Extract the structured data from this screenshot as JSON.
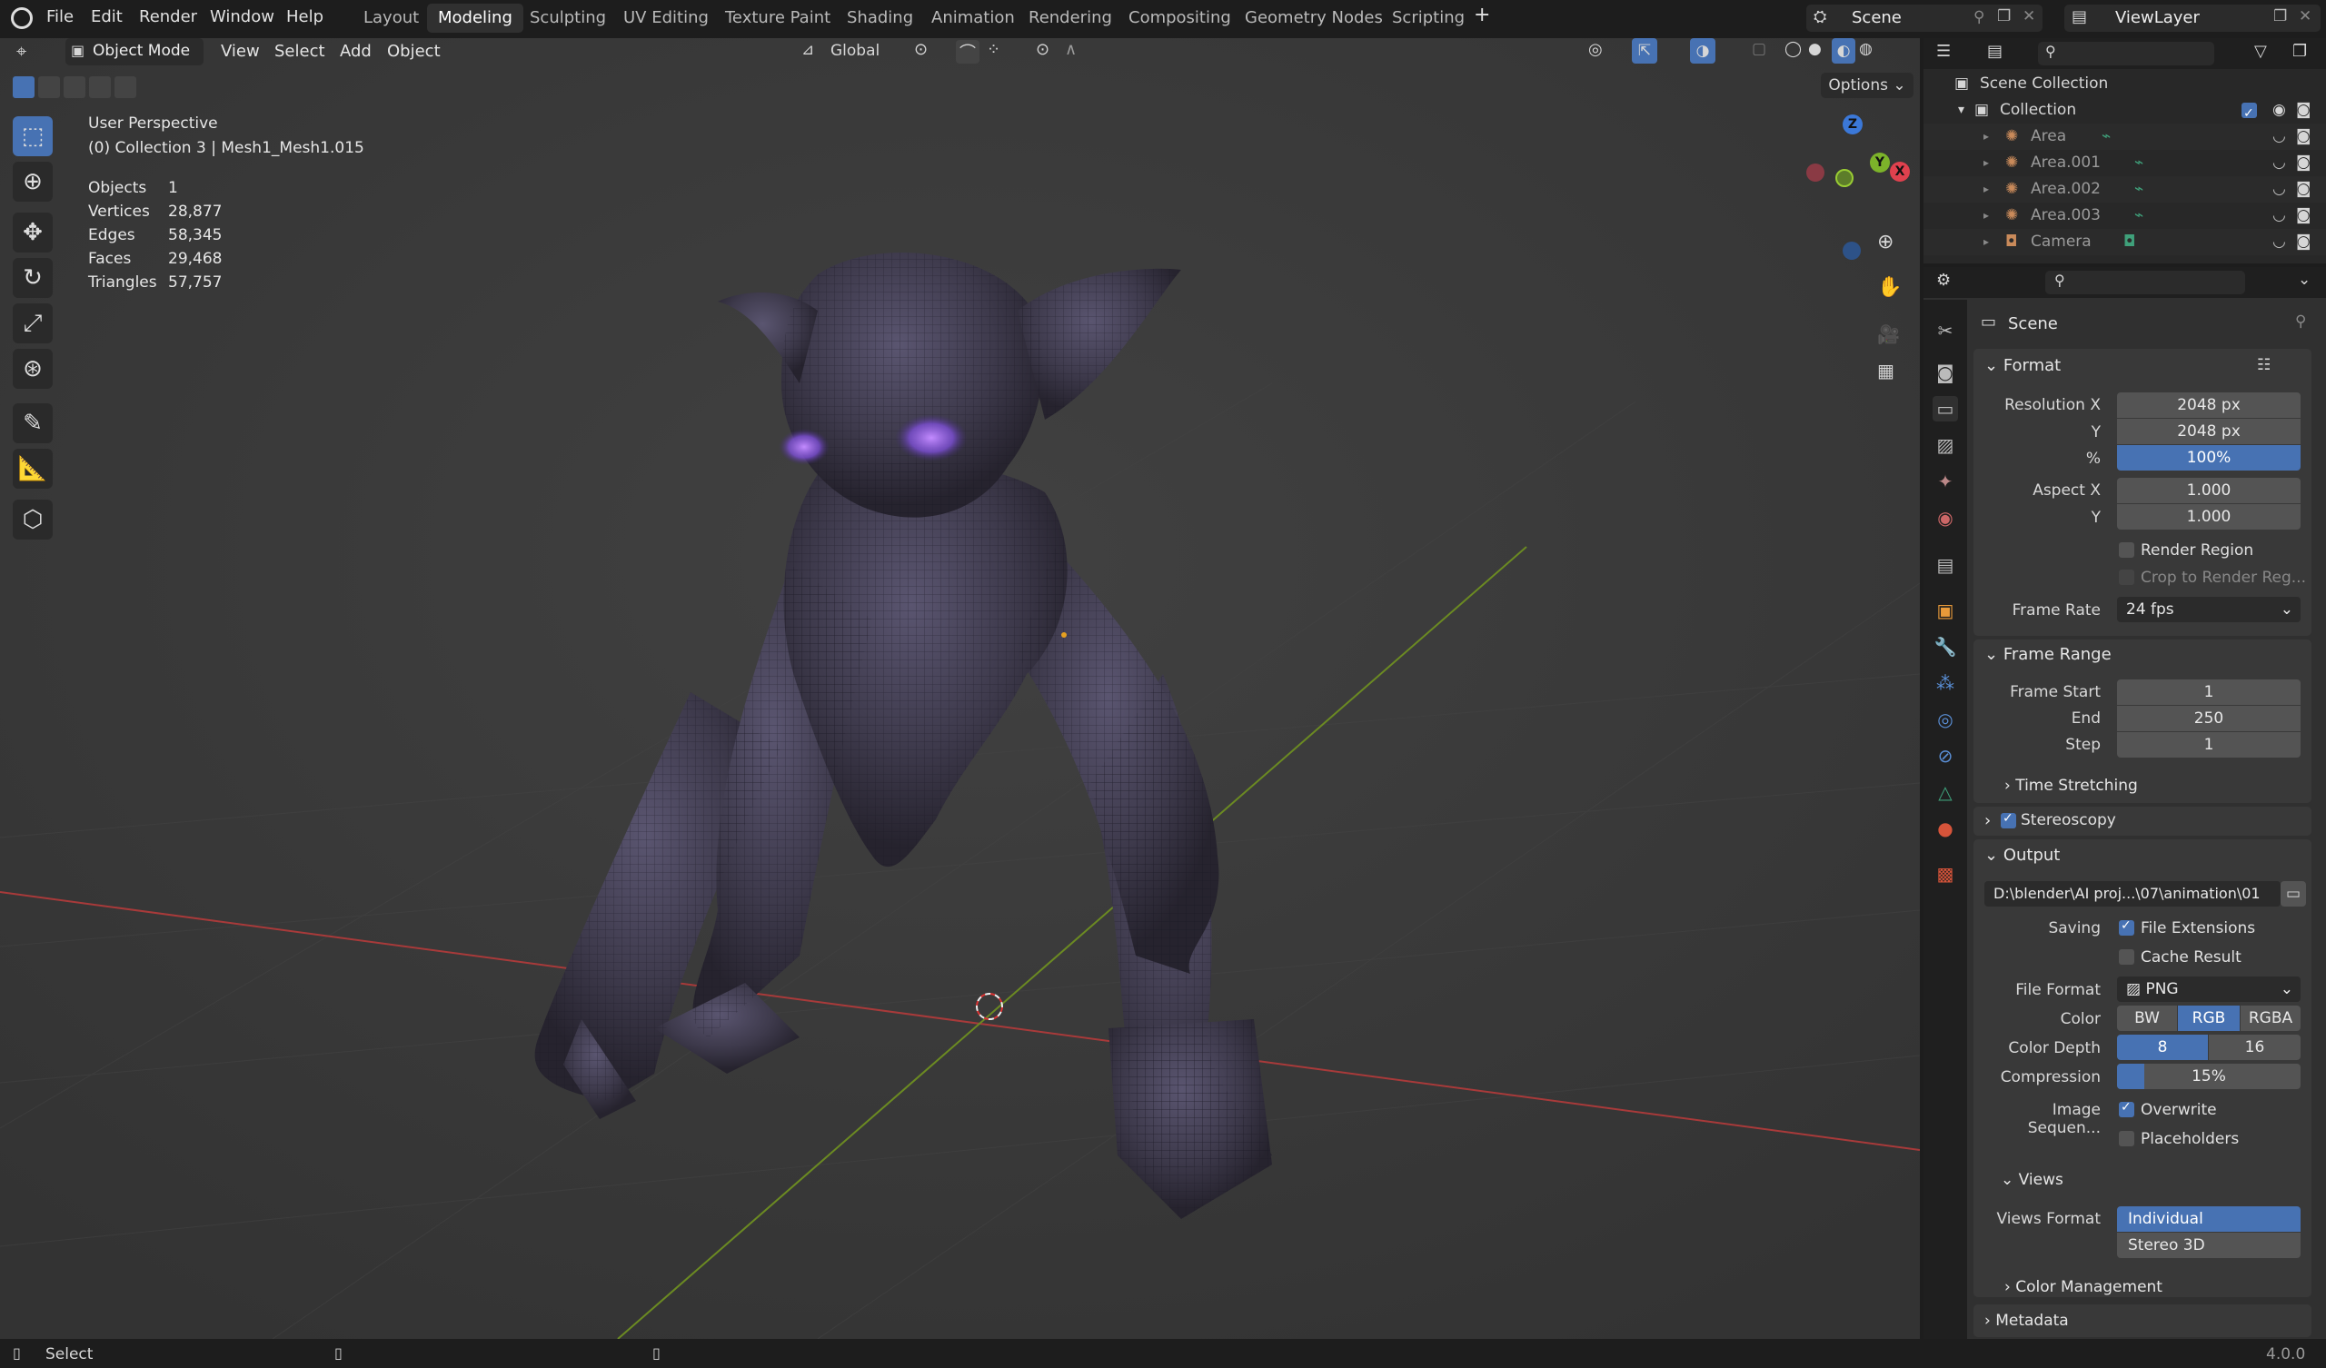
{
  "menu": {
    "file": "File",
    "edit": "Edit",
    "render": "Render",
    "window": "Window",
    "help": "Help"
  },
  "workspaces": [
    "Layout",
    "Modeling",
    "Sculpting",
    "UV Editing",
    "Texture Paint",
    "Shading",
    "Animation",
    "Rendering",
    "Compositing",
    "Geometry Nodes",
    "Scripting"
  ],
  "active_workspace": "Modeling",
  "scene_name": "Scene",
  "view_layer": "ViewLayer",
  "viewport_header": {
    "mode": "Object Mode",
    "view": "View",
    "select": "Select",
    "add": "Add",
    "object": "Object",
    "orientation": "Global",
    "options": "Options"
  },
  "overlay_info": {
    "perspective": "User Perspective",
    "collection": "(0) Collection 3 | Mesh1_Mesh1.015"
  },
  "stats": [
    {
      "label": "Objects",
      "value": "1"
    },
    {
      "label": "Vertices",
      "value": "28,877"
    },
    {
      "label": "Edges",
      "value": "58,345"
    },
    {
      "label": "Faces",
      "value": "29,468"
    },
    {
      "label": "Triangles",
      "value": "57,757"
    }
  ],
  "gizmo": {
    "z": "Z",
    "y": "Y",
    "x": "X"
  },
  "outliner": {
    "scene_collection": "Scene Collection",
    "collection": "Collection",
    "items": [
      "Area",
      "Area.001",
      "Area.002",
      "Area.003",
      "Camera"
    ]
  },
  "properties": {
    "context": "Scene",
    "format": {
      "title": "Format",
      "res_x_label": "Resolution X",
      "res_x": "2048 px",
      "res_y_label": "Y",
      "res_y": "2048 px",
      "pct_label": "%",
      "pct": "100%",
      "aspect_x_label": "Aspect X",
      "aspect_x": "1.000",
      "aspect_y_label": "Y",
      "aspect_y": "1.000",
      "render_region": "Render Region",
      "crop": "Crop to Render Reg...",
      "frame_rate_label": "Frame Rate",
      "frame_rate": "24 fps"
    },
    "frame_range": {
      "title": "Frame Range",
      "start_label": "Frame Start",
      "start": "1",
      "end_label": "End",
      "end": "250",
      "step_label": "Step",
      "step": "1",
      "time_stretching": "Time Stretching"
    },
    "stereoscopy": "Stereoscopy",
    "output": {
      "title": "Output",
      "path": "D:\\blender\\AI proj...\\07\\animation\\01",
      "saving_label": "Saving",
      "file_extensions": "File Extensions",
      "cache_result": "Cache Result",
      "file_format_label": "File Format",
      "file_format": "PNG",
      "color_label": "Color",
      "color_options": [
        "BW",
        "RGB",
        "RGBA"
      ],
      "depth_label": "Color Depth",
      "depth_options": [
        "8",
        "16"
      ],
      "compression_label": "Compression",
      "compression": "15%",
      "image_seq_label": "Image Sequen...",
      "overwrite": "Overwrite",
      "placeholders": "Placeholders",
      "views": "Views",
      "views_format_label": "Views Format",
      "views_options": [
        "Individual",
        "Stereo 3D"
      ],
      "color_management": "Color Management"
    },
    "metadata": "Metadata"
  },
  "status": {
    "select": "Select",
    "version": "4.0.0"
  },
  "colors": {
    "accent": "#4772b3",
    "x_axis": "#b03a3a",
    "y_axis": "#7a9a2a"
  }
}
